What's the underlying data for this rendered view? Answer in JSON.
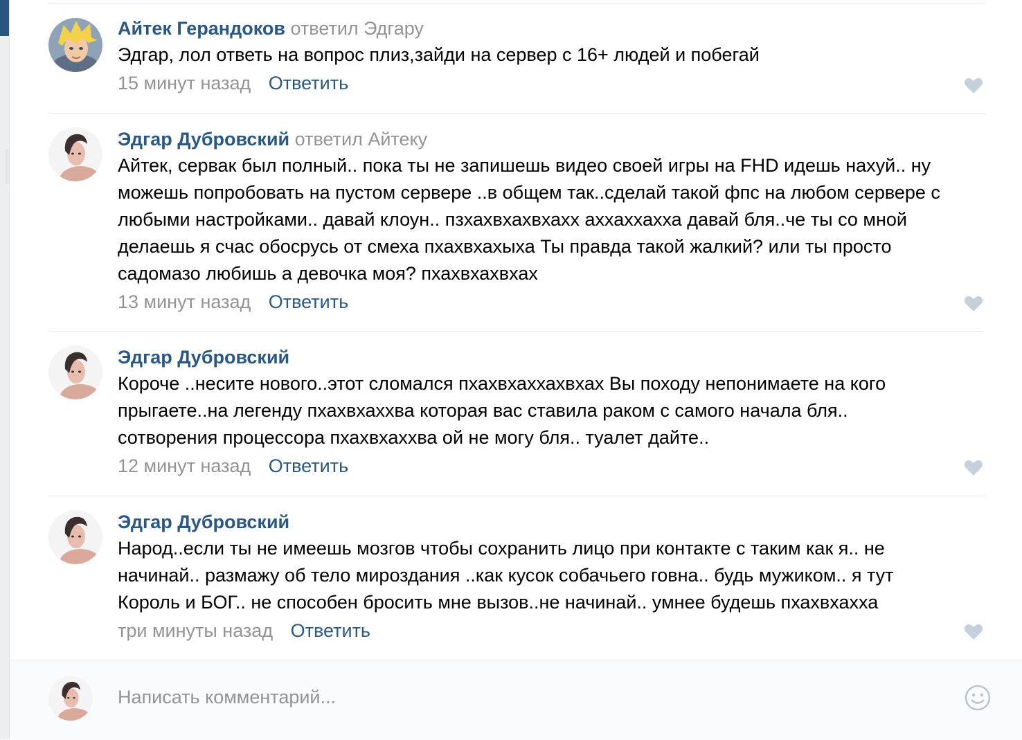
{
  "comments": [
    {
      "author": "Айтек Герандоков",
      "reply_to": "ответил Эдгару",
      "text": "Эдгар, лол ответь на вопрос плиз,зайди на сервер с 16+ людей и побегай",
      "time": "15 минут назад",
      "reply_label": "Ответить",
      "avatar_icon": "cartoon-boy-avatar"
    },
    {
      "author": "Эдгар Дубровский",
      "reply_to": "ответил Айтеку",
      "text": "Айтек, сервак был полный.. пока ты не запишешь видео своей игры на FHD идешь нахуй.. ну можешь попробовать на пустом сервере ..в общем так..сделай такой фпс на любом сервере с любыми настройками.. давай клоун.. пзхахвхахвхахх аххаххахха давай бля..че ты со мной делаешь я счас обосрусь от смеха пхахвхахыха Ты правда такой жалкий? или ты просто садомазо любишь а девочка моя? пхахвхахвхах",
      "time": "13 минут назад",
      "reply_label": "Ответить",
      "avatar_icon": "user-photo-avatar"
    },
    {
      "author": "Эдгар Дубровский",
      "reply_to": "",
      "text": "Короче ..несите нового..этот сломался пхахвхаххахвхах Вы походу непонимаете на кого прыгаете..на легенду пхахвхаххва которая вас ставила раком с самого начала бля.. сотворения процессора пхахвхаххва ой не могу бля.. туалет дайте..",
      "time": "12 минут назад",
      "reply_label": "Ответить",
      "avatar_icon": "user-photo-avatar"
    },
    {
      "author": "Эдгар Дубровский",
      "reply_to": "",
      "text": "Народ..если ты не имеешь мозгов чтобы сохранить лицо при контакте с таким как я.. не начинай.. размажу об тело мироздания ..как кусок собачьего говна.. будь мужиком.. я тут Король и БОГ.. не способен бросить мне вызов..не начинай.. умнее будешь пхахвхахха",
      "time": "три минуты назад",
      "reply_label": "Ответить",
      "avatar_icon": "user-photo-avatar"
    }
  ],
  "composer": {
    "placeholder": "Написать комментарий...",
    "emoji_icon": "smile-icon"
  },
  "colors": {
    "author": "#2a5885",
    "muted": "#939393",
    "divider": "#e7e8ec",
    "like": "#c5d0db"
  }
}
